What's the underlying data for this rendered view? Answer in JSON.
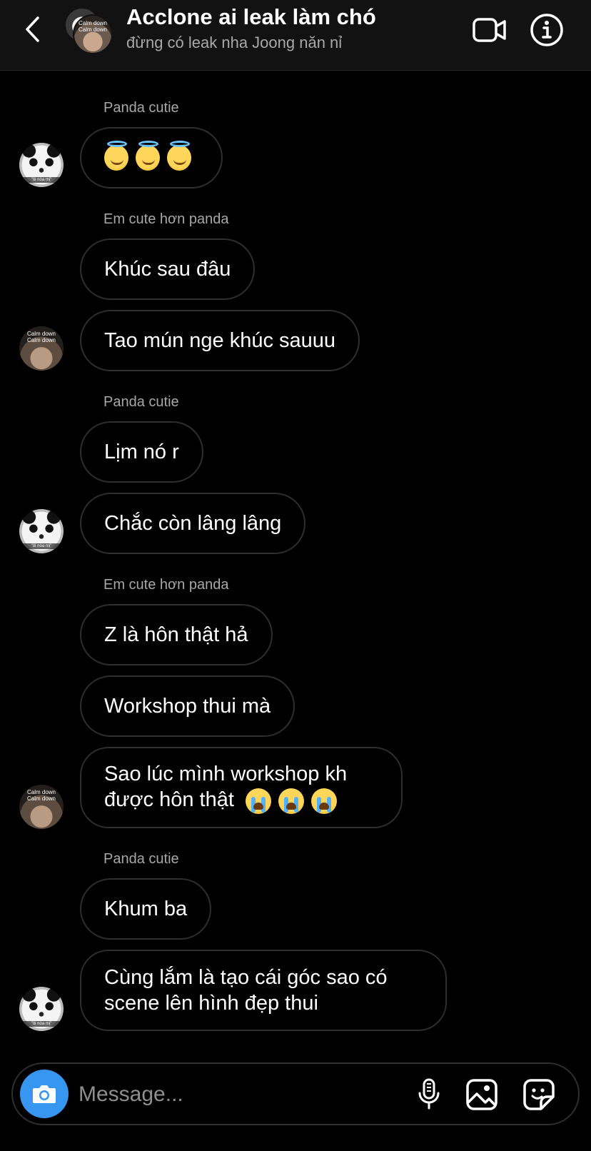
{
  "header": {
    "title": "Acclone ai leak làm chó",
    "subtitle": "đừng có leak nha Joong năn nỉ",
    "group_avatar_caption": "Calm down\nCalm down",
    "icons": {
      "back": "chevron-left-icon",
      "video": "video-camera-icon",
      "info": "info-icon"
    }
  },
  "messages": {
    "g1": {
      "sender": "Panda cutie",
      "m1": "",
      "avatar_caption": "\"ôi nòa mị\""
    },
    "g2": {
      "sender": "Em cute hơn panda",
      "m1": "Khúc sau đâu",
      "m2": "Tao mún nge khúc sauuu",
      "avatar_caption": "Calm down\nCalm down"
    },
    "g3": {
      "sender": "Panda cutie",
      "m1": "Lịm nó r",
      "m2": "Chắc còn lâng lâng",
      "avatar_caption": "\"ôi nòa mị\""
    },
    "g4": {
      "sender": "Em cute hơn panda",
      "m1": "Z là hôn thật hả",
      "m2": "Workshop thui mà",
      "m3_line1": "Sao lúc mình workshop kh",
      "m3_line2": "được hôn thật",
      "avatar_caption": "Calm down\nCalm down"
    },
    "g5": {
      "sender": "Panda cutie",
      "m1": "Khum ba",
      "m2_line1": "Cùng lắm là tạo cái góc sao có",
      "m2_line2": "scene lên hình đẹp thui",
      "avatar_caption": "\"ôi nòa mị\""
    }
  },
  "composer": {
    "placeholder": "Message...",
    "icons": {
      "camera": "camera-icon",
      "mic": "microphone-icon",
      "gallery": "gallery-icon",
      "sticker": "sticker-icon"
    }
  },
  "colors": {
    "accent": "#3797f0",
    "background": "#000000",
    "header_bg": "#121212",
    "bubble_border": "#2e2e2e",
    "muted_text": "#a8a8a8"
  }
}
